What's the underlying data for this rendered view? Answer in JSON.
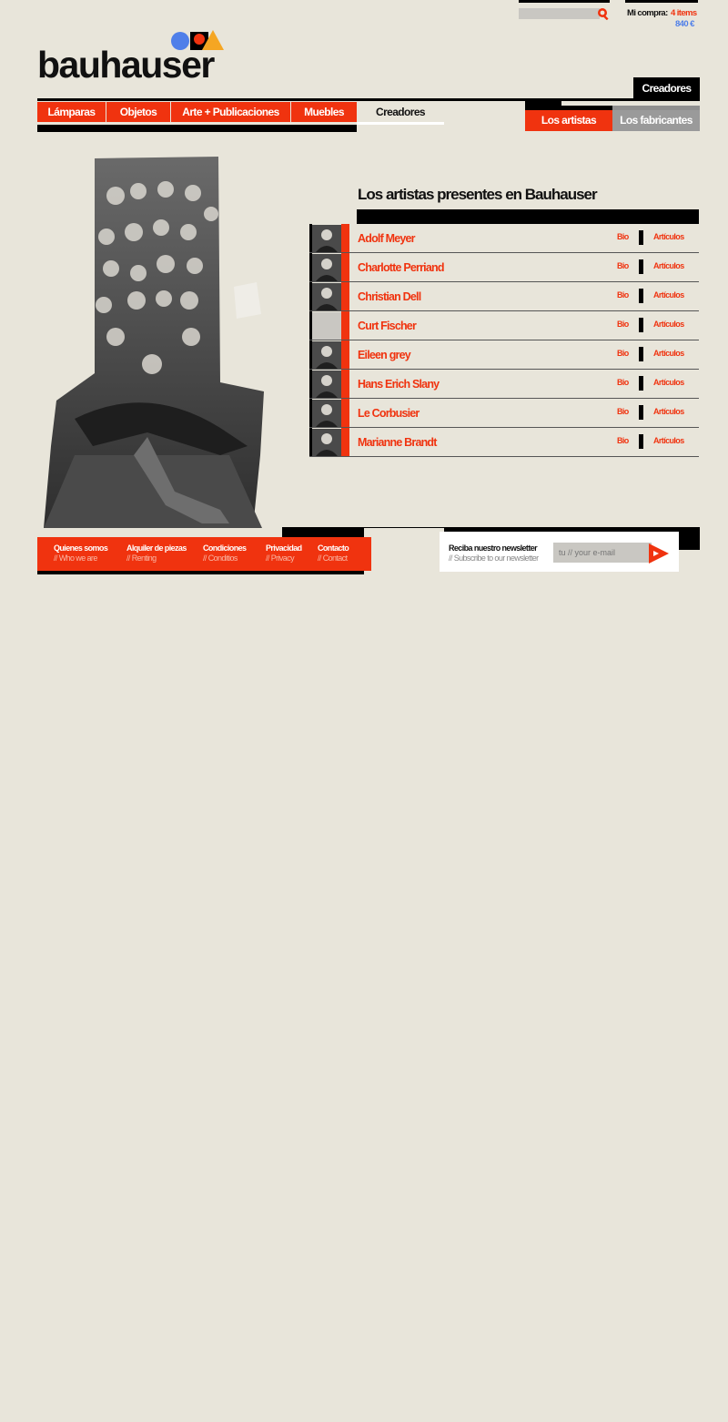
{
  "header": {
    "search": {
      "placeholder": ""
    },
    "cart": {
      "label": "Mi compra:",
      "items": "4 items",
      "total": "840 €"
    }
  },
  "logo": {
    "text": "bauhauser"
  },
  "nav": {
    "items": [
      {
        "label": "Lámparas"
      },
      {
        "label": "Objetos"
      },
      {
        "label": "Arte + Publicaciones"
      },
      {
        "label": "Muebles"
      },
      {
        "label": "Creadores"
      }
    ],
    "section_tab": "Creadores",
    "subtabs": [
      {
        "label": "Los artistas"
      },
      {
        "label": "Los fabricantes"
      }
    ]
  },
  "main": {
    "title": "Los artistas presentes en Bauhauser",
    "artists": [
      {
        "name": "Adolf Meyer",
        "bio": "Bio",
        "articles": "Artículos"
      },
      {
        "name": "Charlotte Perriand",
        "bio": "Bio",
        "articles": "Artículos"
      },
      {
        "name": "Christian Dell",
        "bio": "Bio",
        "articles": "Artículos"
      },
      {
        "name": "Curt Fischer",
        "bio": "Bio",
        "articles": "Artículos"
      },
      {
        "name": "Eileen grey",
        "bio": "Bio",
        "articles": "Artículos"
      },
      {
        "name": "Hans Erich Slany",
        "bio": "Bio",
        "articles": "Artículos"
      },
      {
        "name": "Le Corbusier",
        "bio": "Bio",
        "articles": "Artículos"
      },
      {
        "name": "Marianne Brandt",
        "bio": "Bio",
        "articles": "Artículos"
      }
    ]
  },
  "footer": {
    "links": [
      {
        "label": "Quienes somos",
        "sub": "// Who we are"
      },
      {
        "label": "Alquiler de piezas",
        "sub": "// Renting"
      },
      {
        "label": "Condiciones",
        "sub": "// Conditios"
      },
      {
        "label": "Privacidad",
        "sub": "// Privacy"
      },
      {
        "label": "Contacto",
        "sub": "// Contact"
      }
    ],
    "newsletter": {
      "title": "Reciba nuestro newsletter",
      "subtitle": "// Subscribe to our newsletter",
      "placeholder": "tu // your e-mail"
    }
  },
  "colors": {
    "accent": "#f0330f",
    "background": "#e8e5da",
    "blue": "#4f7fe9",
    "orange": "#f5a623"
  }
}
